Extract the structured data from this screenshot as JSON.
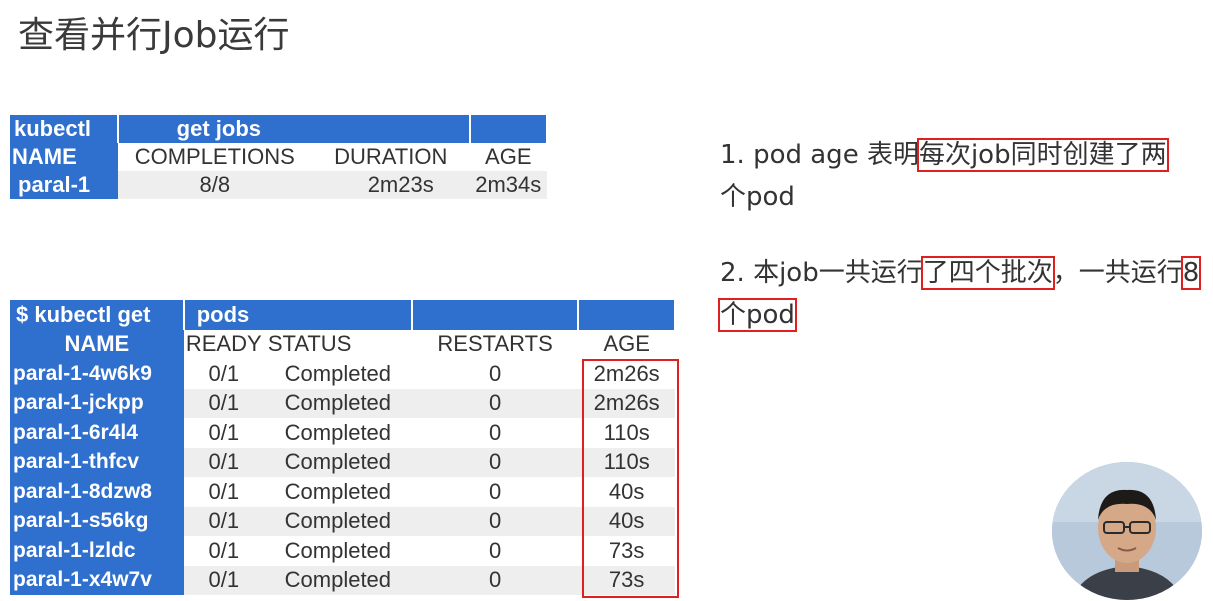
{
  "page": {
    "title": "查看并行Job运行"
  },
  "jobs_table": {
    "command": [
      "kubectl",
      "get jobs"
    ],
    "headers": [
      "NAME",
      "COMPLETIONS",
      "DURATION",
      "AGE"
    ],
    "rows": [
      [
        "paral-1",
        "8/8",
        "2m23s",
        "2m34s"
      ]
    ]
  },
  "pods_table": {
    "command": [
      "$ kubectl  get",
      "pods"
    ],
    "headers": [
      "NAME",
      "READY",
      "STATUS",
      "RESTARTS",
      "AGE"
    ],
    "rows": [
      [
        "paral-1-4w6k9",
        "0/1",
        "Completed",
        "0",
        "2m26s"
      ],
      [
        "paral-1-jckpp",
        "0/1",
        "Completed",
        "0",
        "2m26s"
      ],
      [
        "paral-1-6r4l4",
        "0/1",
        "Completed",
        "0",
        "110s"
      ],
      [
        "paral-1-thfcv",
        "0/1",
        "Completed",
        "0",
        "110s"
      ],
      [
        "paral-1-8dzw8",
        "0/1",
        "Completed",
        "0",
        "40s"
      ],
      [
        "paral-1-s56kg",
        "0/1",
        "Completed",
        "0",
        "40s"
      ],
      [
        "paral-1-lzldc",
        "0/1",
        "Completed",
        "0",
        "73s"
      ],
      [
        "paral-1-x4w7v",
        "0/1",
        "Completed",
        "0",
        "73s"
      ]
    ]
  },
  "notes": {
    "note1_prefix": "1. pod age 表明",
    "note1_highlight": "每次job同时创建了两",
    "note1_suffix": "个pod",
    "note2_prefix": "2. 本job一共运行",
    "note2_highlight1": "了四个批次",
    "note2_middle": "，一共运行",
    "note2_highlight2": "8个pod"
  },
  "colors": {
    "header_blue": "#2f6fcd",
    "highlight_red": "#e02020",
    "row_alt": "#eeeeee"
  }
}
